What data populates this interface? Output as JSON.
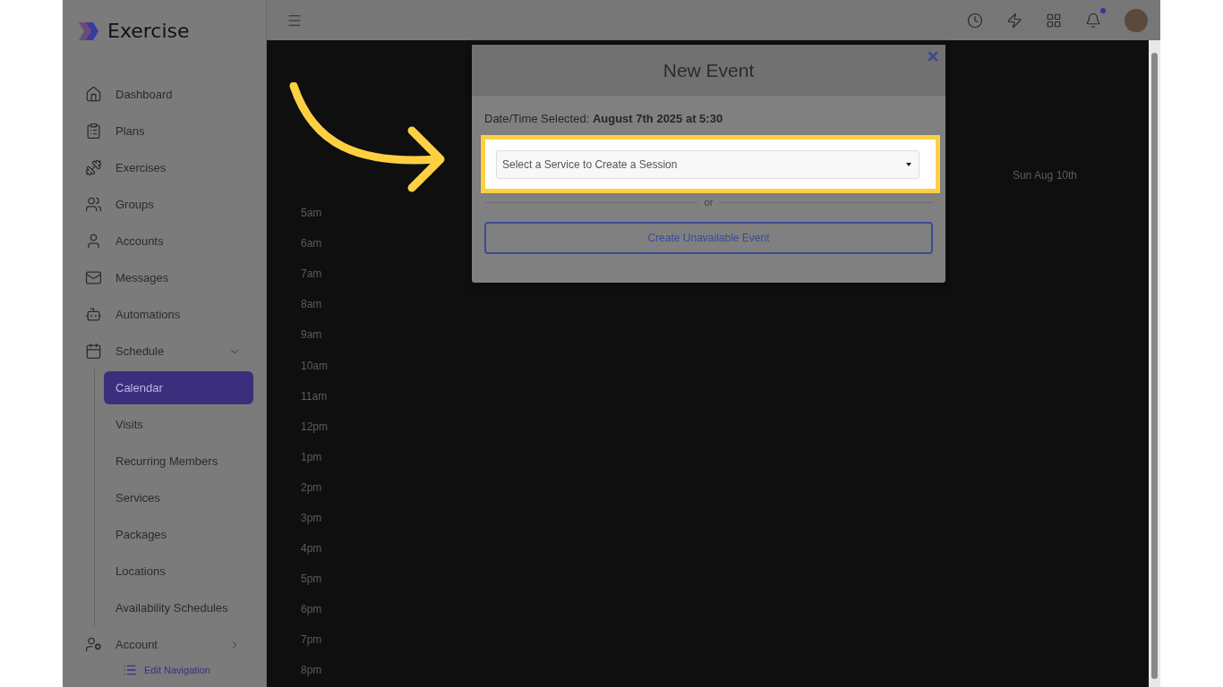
{
  "app": {
    "name": "Exercise"
  },
  "sidebar": {
    "items": [
      {
        "label": "Dashboard"
      },
      {
        "label": "Plans"
      },
      {
        "label": "Exercises"
      },
      {
        "label": "Groups"
      },
      {
        "label": "Accounts"
      },
      {
        "label": "Messages"
      },
      {
        "label": "Automations"
      },
      {
        "label": "Schedule",
        "expanded": true,
        "children": [
          {
            "label": "Calendar",
            "selected": true
          },
          {
            "label": "Visits",
            "selected": false
          },
          {
            "label": "Recurring Members",
            "selected": false
          },
          {
            "label": "Services",
            "selected": false
          },
          {
            "label": "Packages",
            "selected": false
          },
          {
            "label": "Locations",
            "selected": false
          },
          {
            "label": "Availability Schedules",
            "selected": false
          }
        ]
      },
      {
        "label": "Account",
        "expanded": false
      }
    ],
    "edit_link": "Edit Navigation"
  },
  "topbar": {
    "has_notification": true
  },
  "calendar": {
    "day_header": "Sun Aug 10th",
    "hours": [
      "5am",
      "6am",
      "7am",
      "8am",
      "9am",
      "10am",
      "11am",
      "12pm",
      "1pm",
      "2pm",
      "3pm",
      "4pm",
      "5pm",
      "6pm",
      "7pm",
      "8pm"
    ]
  },
  "modal": {
    "title": "New Event",
    "date_label": "Date/Time Selected:",
    "date_value": "August 7th 2025 at 5:30",
    "select": {
      "placeholder": "Select a Service to Create a Session"
    },
    "divider_text": "or",
    "button": "Create Unavailable Event"
  }
}
